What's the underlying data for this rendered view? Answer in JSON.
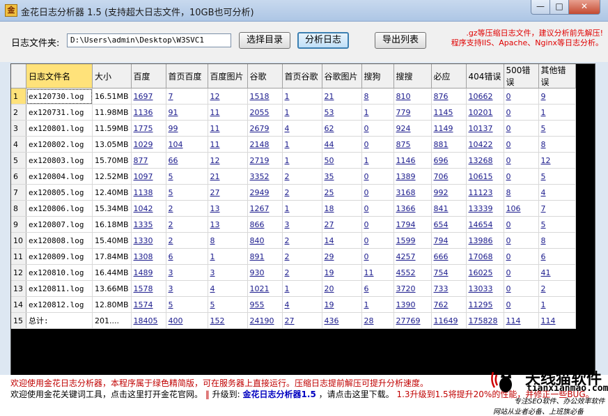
{
  "window": {
    "title": "金花日志分析器 1.5 (支持超大日志文件，10GB也可分析)",
    "app_icon_glyph": "金",
    "min_glyph": "—",
    "max_glyph": "□",
    "close_glyph": "✕"
  },
  "toolbar": {
    "folder_label": "日志文件夹:",
    "folder_path": "D:\\Users\\admin\\Desktop\\W3SVC1",
    "choose_label": "选择目录",
    "analyze_label": "分析日志",
    "export_label": "导出列表",
    "notice_line1": ".gz等压缩日志文件，建议分析前先解压!",
    "notice_line2": "程序支持IIS、Apache、Nginx等日志分析。"
  },
  "table": {
    "headers": [
      "",
      "日志文件名",
      "大小",
      "百度",
      "首页百度",
      "百度图片",
      "谷歌",
      "首页谷歌",
      "谷歌图片",
      "搜狗",
      "搜搜",
      "必应",
      "404错误",
      "500错误",
      "其他错误"
    ],
    "rows": [
      [
        "1",
        "ex120730.log",
        "16.51MB",
        "1697",
        "7",
        "12",
        "1518",
        "1",
        "21",
        "8",
        "810",
        "876",
        "10662",
        "0",
        "9"
      ],
      [
        "2",
        "ex120731.log",
        "11.98MB",
        "1136",
        "91",
        "11",
        "2055",
        "1",
        "53",
        "1",
        "779",
        "1145",
        "10201",
        "0",
        "1"
      ],
      [
        "3",
        "ex120801.log",
        "11.59MB",
        "1775",
        "99",
        "11",
        "2679",
        "4",
        "62",
        "0",
        "924",
        "1149",
        "10137",
        "0",
        "5"
      ],
      [
        "4",
        "ex120802.log",
        "13.05MB",
        "1029",
        "104",
        "11",
        "2148",
        "1",
        "44",
        "0",
        "875",
        "881",
        "10422",
        "0",
        "8"
      ],
      [
        "5",
        "ex120803.log",
        "15.70MB",
        "877",
        "66",
        "12",
        "2719",
        "1",
        "50",
        "1",
        "1146",
        "696",
        "13268",
        "0",
        "12"
      ],
      [
        "6",
        "ex120804.log",
        "12.52MB",
        "1097",
        "5",
        "21",
        "3352",
        "2",
        "35",
        "0",
        "1389",
        "706",
        "10615",
        "0",
        "5"
      ],
      [
        "7",
        "ex120805.log",
        "12.40MB",
        "1138",
        "5",
        "27",
        "2949",
        "2",
        "25",
        "0",
        "3168",
        "992",
        "11123",
        "8",
        "4"
      ],
      [
        "8",
        "ex120806.log",
        "15.34MB",
        "1042",
        "2",
        "13",
        "1267",
        "1",
        "18",
        "0",
        "1366",
        "841",
        "13339",
        "106",
        "7"
      ],
      [
        "9",
        "ex120807.log",
        "16.18MB",
        "1335",
        "2",
        "13",
        "866",
        "3",
        "27",
        "0",
        "1794",
        "654",
        "14654",
        "0",
        "5"
      ],
      [
        "10",
        "ex120808.log",
        "15.40MB",
        "1330",
        "2",
        "8",
        "840",
        "2",
        "14",
        "0",
        "1599",
        "794",
        "13986",
        "0",
        "8"
      ],
      [
        "11",
        "ex120809.log",
        "17.84MB",
        "1308",
        "6",
        "1",
        "891",
        "2",
        "29",
        "0",
        "4257",
        "666",
        "17068",
        "0",
        "6"
      ],
      [
        "12",
        "ex120810.log",
        "16.44MB",
        "1489",
        "3",
        "3",
        "930",
        "2",
        "19",
        "11",
        "4552",
        "754",
        "16025",
        "0",
        "41"
      ],
      [
        "13",
        "ex120811.log",
        "13.66MB",
        "1578",
        "3",
        "4",
        "1021",
        "1",
        "20",
        "6",
        "3720",
        "733",
        "13033",
        "0",
        "2"
      ],
      [
        "14",
        "ex120812.log",
        "12.80MB",
        "1574",
        "5",
        "5",
        "955",
        "4",
        "19",
        "1",
        "1390",
        "762",
        "11295",
        "0",
        "1"
      ],
      [
        "15",
        "总计:",
        "201....",
        "18405",
        "400",
        "152",
        "24190",
        "27",
        "436",
        "28",
        "27769",
        "11649",
        "175828",
        "114",
        "114"
      ]
    ]
  },
  "footer": {
    "line1": "欢迎使用金花日志分析器，本程序属于绿色精简版，可在服务器上直接运行。压缩日志提前解压可提升分析速度。",
    "line2_a": "欢迎使用金花关键词工具，点击这里打开金花官网。",
    "line2_sep": "‖",
    "line2_b": "升级到:",
    "line2_c": "金花日志分析器1.5",
    "line2_d": "，请点击这里下载。",
    "line2_e": "1.3升级到1.5将提升20%的性能，并修正一些BUG。"
  },
  "watermark": {
    "logo": "天线猫软件",
    "site": "tianxianmao.com",
    "slogan1": "专注SEO软件、办公效率软件",
    "slogan2": "网站从业者必备、上班族必备"
  },
  "colors": {
    "notice": "#e00000",
    "selected_header": "#ffe27a",
    "link": "#1a1a8c"
  }
}
